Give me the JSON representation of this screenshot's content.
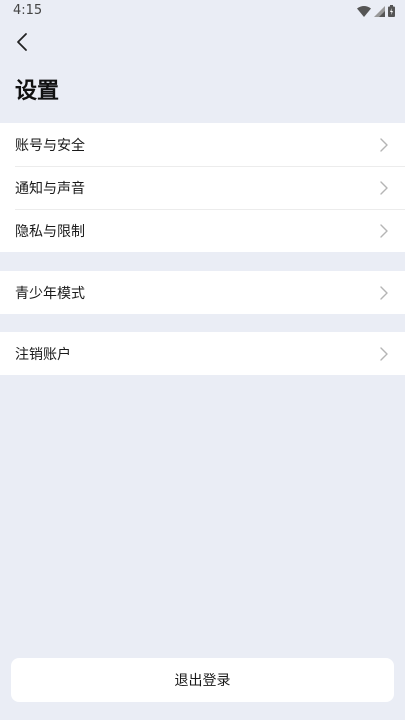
{
  "status_bar": {
    "time": "4:15",
    "icons": [
      "wifi-icon",
      "signal-icon",
      "battery-icon"
    ]
  },
  "header": {
    "back_icon": "chevron-left-icon",
    "title": "设置"
  },
  "groups": [
    {
      "items": [
        {
          "label": "账号与安全",
          "icon": "chevron-right-icon"
        },
        {
          "label": "通知与声音",
          "icon": "chevron-right-icon"
        },
        {
          "label": "隐私与限制",
          "icon": "chevron-right-icon"
        }
      ]
    },
    {
      "items": [
        {
          "label": "青少年模式",
          "icon": "chevron-right-icon"
        }
      ]
    },
    {
      "items": [
        {
          "label": "注销账户",
          "icon": "chevron-right-icon"
        }
      ]
    }
  ],
  "footer": {
    "logout_label": "退出登录"
  },
  "colors": {
    "background": "#eaedf5",
    "card": "#ffffff",
    "text": "#1a1a1a",
    "chevron": "#b5b5b5"
  }
}
